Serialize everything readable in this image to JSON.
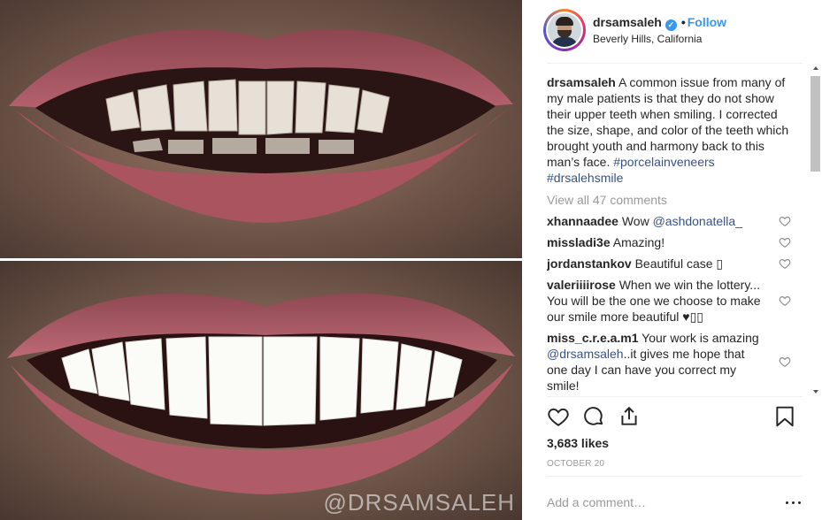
{
  "photo": {
    "watermark": "@DRSAMSALEH",
    "colors": {
      "lips": "#a3555f",
      "skin": "#8f6b5a",
      "teeth_before": "#e6e0d6",
      "teeth_after": "#fbfbf8"
    }
  },
  "post": {
    "username": "drsamsaleh",
    "verified": true,
    "separator": "•",
    "follow_label": "Follow",
    "location": "Beverly Hills, California",
    "caption": {
      "username": "drsamsaleh",
      "text": "A common issue from many of my male patients is that they do not show their upper teeth when smiling. I corrected the size, shape, and color of the teeth which brought youth and harmony back to this man’s face.",
      "hashtags": [
        "#porcelainveneers",
        "#drsalehsmile"
      ]
    },
    "view_all_comments": "View all 47 comments",
    "comments": [
      {
        "username": "xhannaadee",
        "text": "Wow ",
        "mention": "@ashdonatella_",
        "after": ""
      },
      {
        "username": "missladi3e",
        "text": "Amazing!",
        "mention": "",
        "after": ""
      },
      {
        "username": "jordanstankov",
        "text": "Beautiful case ▯",
        "mention": "",
        "after": ""
      },
      {
        "username": "valeriiiirose",
        "text": "When we win the lottery... You will be the one we choose to make our smile more beautiful ♥▯▯",
        "mention": "",
        "after": ""
      },
      {
        "username": "miss_c.r.e.a.m1",
        "text": "Your work is amazing ",
        "mention": "@drsamsaleh",
        "after": "..it gives me hope that one day I can have you correct my smile!"
      }
    ],
    "likes": "3,683 likes",
    "date": "OCTOBER 20",
    "add_comment_placeholder": "Add a comment…",
    "icons": [
      "heart-icon",
      "comment-icon",
      "share-icon",
      "bookmark-icon",
      "more-options-icon"
    ],
    "accent_color": "#3897f0",
    "link_color": "#385185"
  }
}
